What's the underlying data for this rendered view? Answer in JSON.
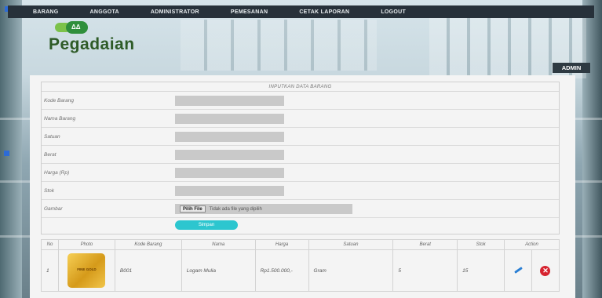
{
  "nav": {
    "items": [
      "BARANG",
      "ANGGOTA",
      "ADMINISTRATOR",
      "PEMESANAN",
      "CETAK LAPORAN",
      "LOGOUT"
    ]
  },
  "brand": {
    "logo_text": "Pegadaian",
    "logo_mark_text": "ΔΔ"
  },
  "user_badge": "ADMIN",
  "form": {
    "title": "INPUTKAN DATA BARANG",
    "fields": [
      {
        "label": "Kode Barang",
        "value": ""
      },
      {
        "label": "Nama Barang",
        "value": ""
      },
      {
        "label": "Satuan",
        "value": ""
      },
      {
        "label": "Berat",
        "value": ""
      },
      {
        "label": "Harga (Rp)",
        "value": ""
      },
      {
        "label": "Stok",
        "value": ""
      }
    ],
    "image_field": {
      "label": "Gambar",
      "button_label": "Pilih File",
      "status_text": "Tidak ada file yang dipilih"
    },
    "submit_label": "Simpan"
  },
  "table": {
    "columns": [
      "No",
      "Photo",
      "Kode Barang",
      "Nama",
      "Harga",
      "Satuan",
      "Berat",
      "Stok",
      "Action"
    ],
    "rows": [
      {
        "no": "1",
        "photo_caption": "FINE GOLD",
        "kode": "B001",
        "nama": "Logam Mulia",
        "harga": "Rp1.500.000,-",
        "satuan": "Gram",
        "berat": "5",
        "stok": "15"
      }
    ]
  },
  "colors": {
    "nav_bg": "#27313a",
    "accent_button": "#2cc6cf",
    "delete_icon": "#d6232f",
    "edit_icon": "#2a7fd4",
    "brand_green": "#2e5b27"
  }
}
